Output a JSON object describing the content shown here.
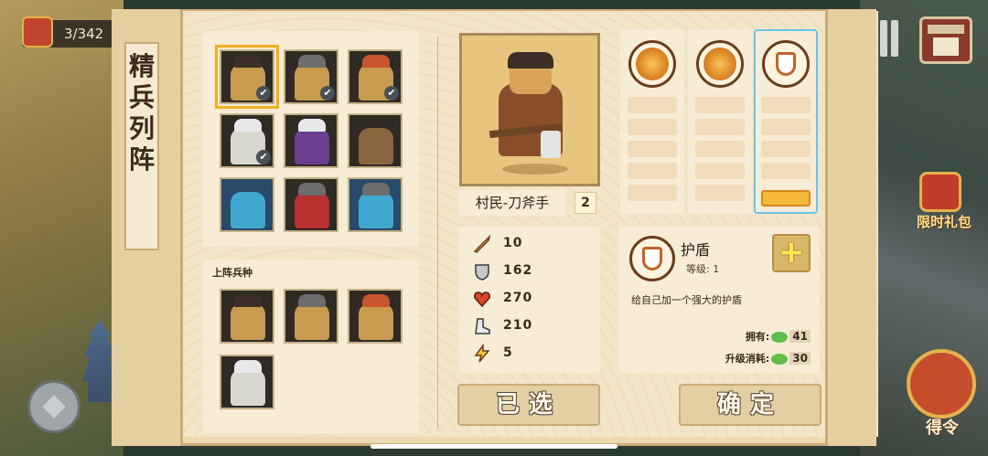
{
  "hud": {
    "progress_counter": "3/342",
    "limited_pack_label": "限时礼包",
    "order_label": "得令"
  },
  "panel": {
    "title": "精兵列阵"
  },
  "roster": {
    "units": [
      {
        "name": "村民-刀斧手",
        "selected": true,
        "checked": true
      },
      {
        "checked": true
      },
      {
        "checked": true
      },
      {
        "checked": true
      },
      {
        "checked": false
      },
      {
        "checked": false
      },
      {
        "checked": false
      },
      {
        "checked": false
      },
      {
        "checked": false
      }
    ]
  },
  "deployed": {
    "title": "上阵兵种",
    "count": 4
  },
  "unit_detail": {
    "name": "村民-刀斧手",
    "level": "2",
    "stats": {
      "attack": "10",
      "defense": "162",
      "health": "270",
      "speed": "210",
      "energy": "5"
    }
  },
  "skills": {
    "columns": [
      {
        "icon": "slash-skill-icon",
        "active": false
      },
      {
        "icon": "swipe-skill-icon",
        "active": false
      },
      {
        "icon": "shield-skill-icon",
        "active": true
      }
    ]
  },
  "skill_detail": {
    "name": "护盾",
    "level_label": "等级:",
    "level_value": "1",
    "description": "给自己加一个强大的护盾",
    "owned_label": "拥有:",
    "owned_value": "41",
    "cost_label": "升级消耗:",
    "cost_value": "30",
    "plus_label": "+"
  },
  "buttons": {
    "selected": "已选",
    "confirm": "确定"
  },
  "colors": {
    "panel": "#ecd9b0",
    "active_skill_border": "#6cc5e8",
    "gem": "#5fbf4a"
  }
}
